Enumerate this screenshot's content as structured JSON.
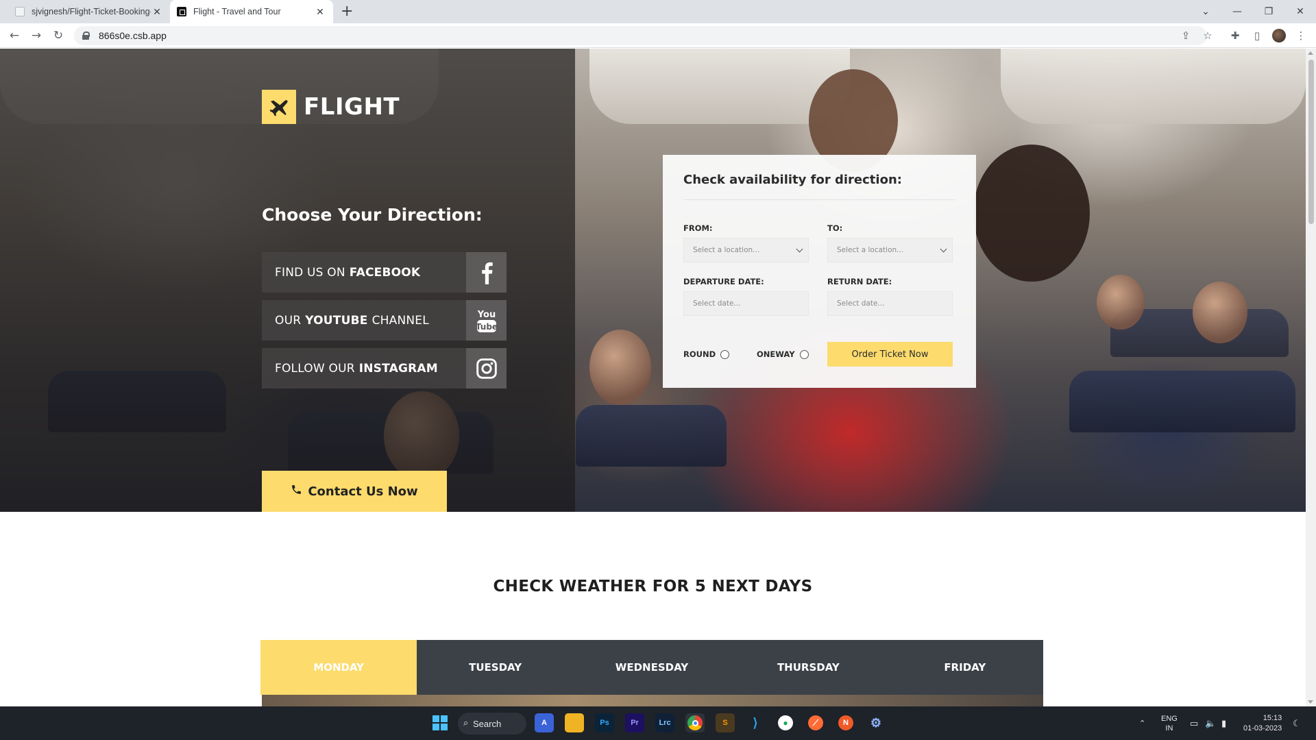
{
  "browser": {
    "tabs": [
      {
        "title": "sjvignesh/Flight-Ticket-Booking-",
        "active": false
      },
      {
        "title": "Flight - Travel and Tour",
        "active": true
      }
    ],
    "new_tab": "+",
    "url": "866s0e.csb.app"
  },
  "hero": {
    "brand": "FLIGHT",
    "direction_title": "Choose Your Direction:",
    "social_links": [
      {
        "prefix": "FIND US ON",
        "bold": "FACEBOOK",
        "icon": "facebook-icon"
      },
      {
        "prefix": "OUR",
        "bold": "YOUTUBE",
        "suffix": "CHANNEL",
        "icon": "youtube-icon"
      },
      {
        "prefix": "FOLLOW OUR",
        "bold": "INSTAGRAM",
        "icon": "instagram-icon"
      }
    ],
    "contact_label": "Contact Us Now"
  },
  "booking": {
    "title": "Check availability for direction:",
    "from_label": "FROM:",
    "to_label": "TO:",
    "from_placeholder": "Select a location...",
    "to_placeholder": "Select a location...",
    "departure_label": "DEPARTURE DATE:",
    "return_label": "RETURN DATE:",
    "departure_placeholder": "Select date...",
    "return_placeholder": "Select date...",
    "round_label": "ROUND",
    "oneway_label": "ONEWAY",
    "order_label": "Order Ticket Now"
  },
  "weather": {
    "title": "CHECK WEATHER FOR 5 NEXT DAYS",
    "days": [
      "MONDAY",
      "TUESDAY",
      "WEDNESDAY",
      "THURSDAY",
      "FRIDAY"
    ],
    "active_day": "MONDAY"
  },
  "taskbar": {
    "search_label": "Search",
    "lang_line1": "ENG",
    "lang_line2": "IN",
    "time": "15:13",
    "date": "01-03-2023"
  },
  "colors": {
    "accent": "#fddb6d",
    "tab_bar": "#3c4148",
    "overlay": "#1c1a1a"
  }
}
